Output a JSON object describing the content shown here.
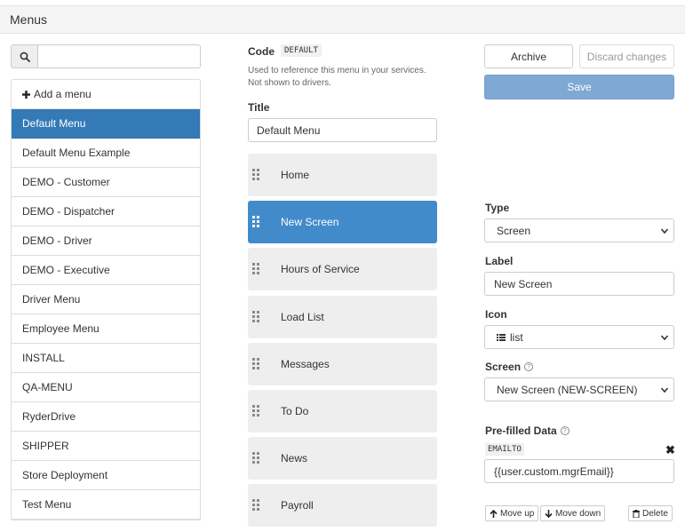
{
  "header": {
    "title": "Menus"
  },
  "search": {
    "icon": "search-icon",
    "placeholder": "",
    "value": ""
  },
  "menu_list": {
    "add_label": "Add a menu",
    "items": [
      {
        "label": "Default Menu",
        "active": true
      },
      {
        "label": "Default Menu Example"
      },
      {
        "label": "DEMO - Customer"
      },
      {
        "label": "DEMO - Dispatcher"
      },
      {
        "label": "DEMO - Driver"
      },
      {
        "label": "DEMO - Executive"
      },
      {
        "label": "Driver Menu"
      },
      {
        "label": "Employee Menu"
      },
      {
        "label": "INSTALL"
      },
      {
        "label": "QA-MENU"
      },
      {
        "label": "RyderDrive"
      },
      {
        "label": "SHIPPER"
      },
      {
        "label": "Store Deployment"
      },
      {
        "label": "Test Menu"
      }
    ]
  },
  "editor": {
    "code_label": "Code",
    "code_value": "DEFAULT",
    "code_help": "Used to reference this menu in your services. Not shown to drivers.",
    "title_label": "Title",
    "title_value": "Default Menu",
    "screens": [
      {
        "label": "Home"
      },
      {
        "label": "New Screen",
        "active": true
      },
      {
        "label": "Hours of Service"
      },
      {
        "label": "Load List"
      },
      {
        "label": "Messages"
      },
      {
        "label": "To Do"
      },
      {
        "label": "News"
      },
      {
        "label": "Payroll"
      }
    ]
  },
  "actions": {
    "archive": "Archive",
    "discard": "Discard changes",
    "save": "Save"
  },
  "detail": {
    "type_label": "Type",
    "type_value": "Screen",
    "label_label": "Label",
    "label_value": "New Screen",
    "icon_label": "Icon",
    "icon_value": "list",
    "screen_label": "Screen",
    "screen_value": "New Screen (NEW-SCREEN)",
    "prefilled_label": "Pre-filled Data",
    "prefilled_key": "EMAILTO",
    "prefilled_value": "{{user.custom.mgrEmail}}",
    "move_up": "Move up",
    "move_down": "Move down",
    "delete": "Delete"
  },
  "colors": {
    "accent": "#337ab7",
    "active_screen": "#428bca",
    "save_disabled": "#7fa8d4"
  }
}
